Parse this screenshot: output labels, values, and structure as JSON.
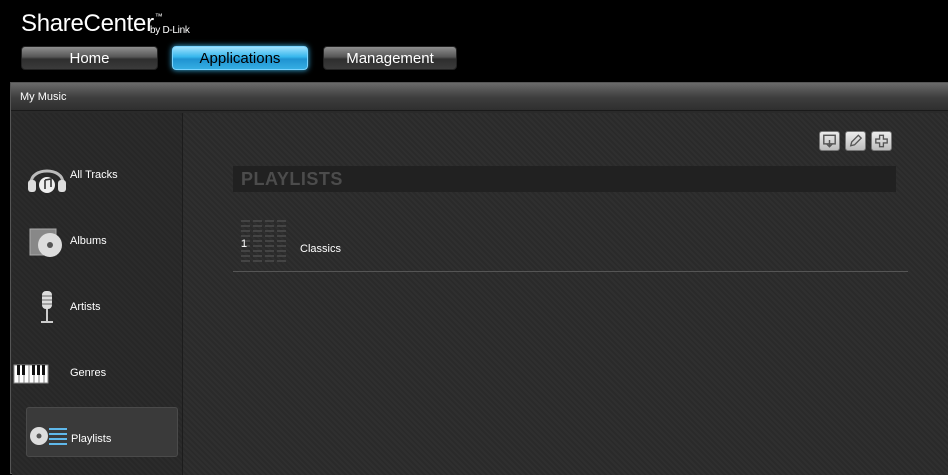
{
  "header": {
    "logo_main": "ShareCenter",
    "logo_tm": "™",
    "logo_by": "by D-Link",
    "nav": {
      "home": "Home",
      "applications": "Applications",
      "management": "Management"
    }
  },
  "panel": {
    "title": "My Music"
  },
  "sidebar": {
    "items": [
      {
        "label": "All Tracks",
        "icon": "headphones-icon"
      },
      {
        "label": "Albums",
        "icon": "album-cd-icon"
      },
      {
        "label": "Artists",
        "icon": "microphone-icon"
      },
      {
        "label": "Genres",
        "icon": "piano-keys-icon"
      },
      {
        "label": "Playlists",
        "icon": "playlist-icon",
        "active": true
      }
    ]
  },
  "toolbar": {
    "icons": [
      "export-icon",
      "edit-pencil-icon",
      "add-icon"
    ]
  },
  "playlists": {
    "header": "PLAYLISTS",
    "rows": [
      {
        "number": "1",
        "name": "Classics"
      }
    ]
  },
  "colors": {
    "accent_blue": "#35b6ec",
    "background": "#2a2a2a"
  }
}
